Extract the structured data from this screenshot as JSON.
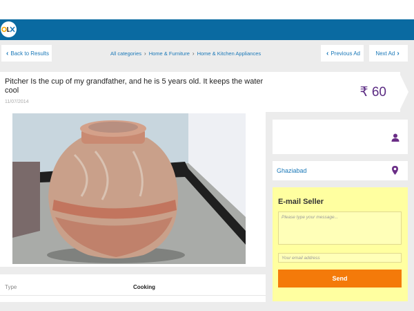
{
  "header": {
    "logo_text": "OLX",
    "brand_color": "#0a6aa1"
  },
  "nav": {
    "back_label": "Back to Results",
    "prev_label": "Previous Ad",
    "next_label": "Next Ad",
    "breadcrumbs": [
      "All categories",
      "Home & Furniture",
      "Home & Kitchen Appliances"
    ]
  },
  "ad": {
    "title": "Pitcher Is the cup of my grandfather, and he is 5 years old. It keeps the water cool",
    "date": "11/07/2014",
    "price": "₹ 60",
    "price_color": "#5a2a82",
    "details": [
      {
        "label": "Type",
        "value": "Cooking"
      }
    ]
  },
  "seller": {
    "location": "Ghaziabad",
    "icon_color": "#6a2d86"
  },
  "email_form": {
    "title": "E-mail Seller",
    "message_placeholder": "Please type your message...",
    "email_placeholder": "Your email address",
    "send_label": "Send",
    "send_color": "#f47a0a"
  }
}
